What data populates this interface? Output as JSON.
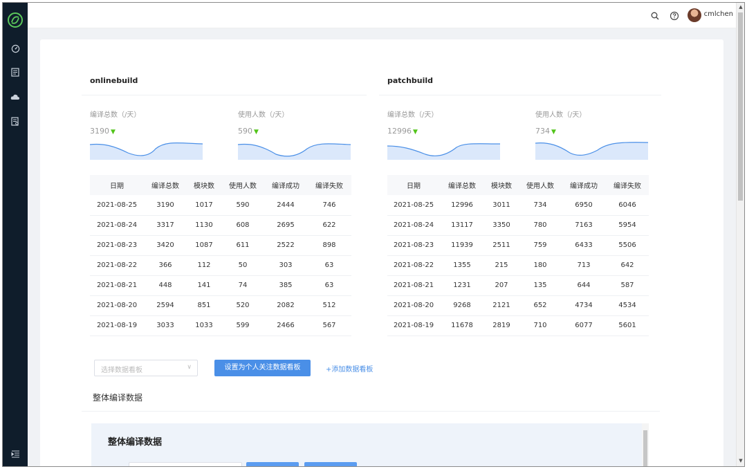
{
  "header": {
    "username": "cmlchen",
    "icons": [
      "search-icon",
      "help-icon",
      "avatar"
    ]
  },
  "sidebar": {
    "icons": [
      "dashboard-icon",
      "document-icon",
      "cloud-icon",
      "report-icon",
      "menu-fold-icon"
    ]
  },
  "panels": [
    {
      "title": "onlinebuild",
      "stats": [
        {
          "label": "编译总数（/天）",
          "value": "3190"
        },
        {
          "label": "使用人数（/天）",
          "value": "590"
        }
      ],
      "columns": [
        "日期",
        "编译总数",
        "模块数",
        "使用人数",
        "编译成功",
        "编译失败"
      ],
      "rows": [
        [
          "2021-08-25",
          "3190",
          "1017",
          "590",
          "2444",
          "746"
        ],
        [
          "2021-08-24",
          "3317",
          "1130",
          "608",
          "2695",
          "622"
        ],
        [
          "2021-08-23",
          "3420",
          "1087",
          "611",
          "2522",
          "898"
        ],
        [
          "2021-08-22",
          "366",
          "112",
          "50",
          "303",
          "63"
        ],
        [
          "2021-08-21",
          "448",
          "141",
          "74",
          "385",
          "63"
        ],
        [
          "2021-08-20",
          "2594",
          "851",
          "520",
          "2082",
          "512"
        ],
        [
          "2021-08-19",
          "3033",
          "1033",
          "599",
          "2466",
          "567"
        ]
      ]
    },
    {
      "title": "patchbuild",
      "stats": [
        {
          "label": "编译总数（/天）",
          "value": "12996"
        },
        {
          "label": "使用人数（/天）",
          "value": "734"
        }
      ],
      "columns": [
        "日期",
        "编译总数",
        "模块数",
        "使用人数",
        "编译成功",
        "编译失败"
      ],
      "rows": [
        [
          "2021-08-25",
          "12996",
          "3011",
          "734",
          "6950",
          "6046"
        ],
        [
          "2021-08-24",
          "13117",
          "3350",
          "780",
          "7163",
          "5954"
        ],
        [
          "2021-08-23",
          "11939",
          "2511",
          "759",
          "6433",
          "5506"
        ],
        [
          "2021-08-22",
          "1355",
          "215",
          "180",
          "713",
          "642"
        ],
        [
          "2021-08-21",
          "1231",
          "207",
          "135",
          "644",
          "587"
        ],
        [
          "2021-08-20",
          "9268",
          "2121",
          "652",
          "4734",
          "4534"
        ],
        [
          "2021-08-19",
          "11678",
          "2819",
          "710",
          "6077",
          "5601"
        ]
      ]
    }
  ],
  "controls": {
    "select_placeholder": "选择数据看板",
    "set_personal_button": "设置为个人关注数据看板",
    "add_board_link": "+添加数据看板"
  },
  "section": {
    "title": "整体编译数据",
    "subpanel_title": "整体编译数据"
  },
  "colors": {
    "sidebar_bg": "#0f1d2b",
    "accent": "#4a8fe7",
    "trend_down": "#52c41a",
    "sparkline_fill": "#dbe8fb",
    "sparkline_stroke": "#4a8fe7"
  }
}
